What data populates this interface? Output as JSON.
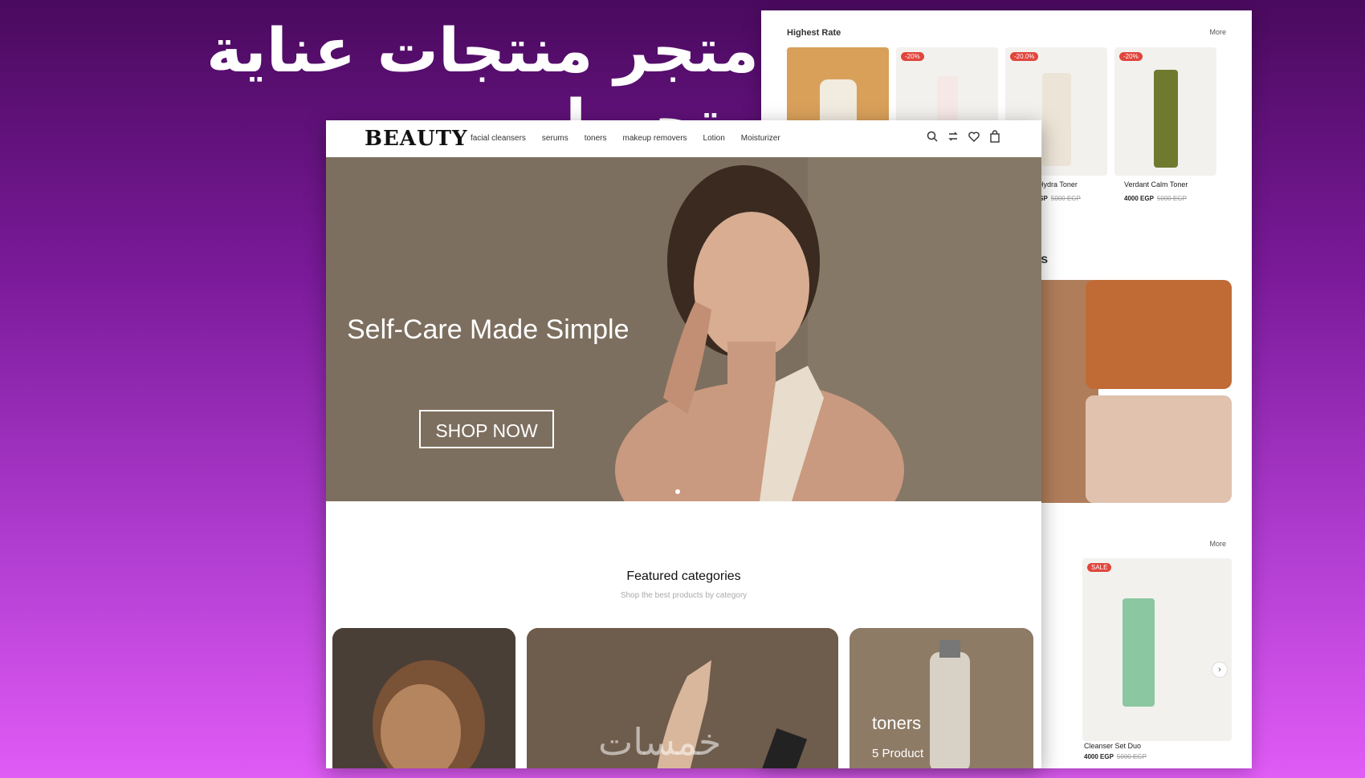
{
  "headline": "متجر منتجات عناية وتجميل.",
  "watermark": "خمسات",
  "back_panel": {
    "section_title": "Highest Rate",
    "more_label": "More",
    "more_label_2": "More",
    "products": [
      {
        "badge": "",
        "name": "",
        "price": "",
        "old_price": ""
      },
      {
        "badge": "-20%",
        "name": "",
        "price": "",
        "old_price": ""
      },
      {
        "badge": "-20.0%",
        "name": "Hydra Toner",
        "price": "EGP",
        "old_price": "5000 EGP"
      },
      {
        "badge": "-20%",
        "name": "Verdant Calm Toner",
        "price": "4000 EGP",
        "old_price": "5000 EGP"
      }
    ],
    "section2_title_fragment": "rs",
    "bottom_product": {
      "badge": "SALE",
      "name": "Cleanser Set Duo",
      "price": "4000 EGP",
      "old_price": "5000 EGP"
    },
    "next_arrow": "›"
  },
  "front_panel": {
    "logo": "BEAUTY",
    "nav": [
      "facial cleansers",
      "serums",
      "toners",
      "makeup removers",
      "Lotion",
      "Moisturizer"
    ],
    "hero": {
      "title": "Self-Care Made Simple",
      "cta": "SHOP NOW"
    },
    "featured": {
      "title": "Featured categories",
      "subtitle": "Shop the best products by category"
    },
    "categories": [
      {
        "label": "",
        "count": ""
      },
      {
        "label": "",
        "count": ""
      },
      {
        "label": "toners",
        "count": "5 Product"
      }
    ]
  },
  "colors": {
    "bg_top": "#4a0a5e",
    "bg_bottom": "#e05cf6",
    "badge": "#e0453c",
    "hero": "#7d6f5f"
  },
  "icons": [
    "search-icon",
    "compare-icon",
    "heart-icon",
    "bag-icon",
    "chevron-right-icon"
  ]
}
